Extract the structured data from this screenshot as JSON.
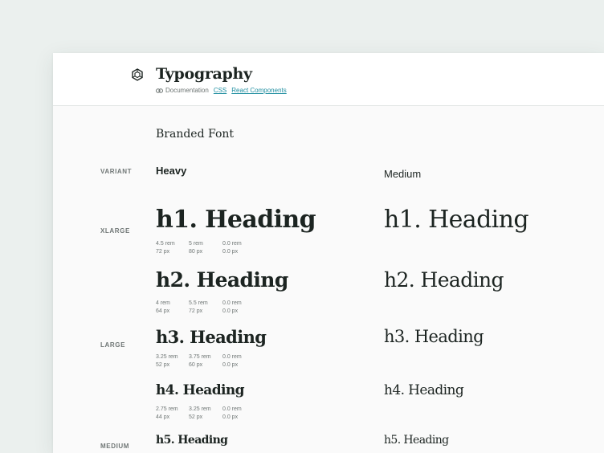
{
  "header": {
    "title": "Typography",
    "links": {
      "documentation": "Documentation",
      "css": "CSS",
      "react": "React Components"
    }
  },
  "section": {
    "title": "Branded Font"
  },
  "labels": {
    "variant": "VARIANT",
    "xlarge": "XLARGE",
    "large": "LARGE",
    "medium": "MEDIUM"
  },
  "variants": {
    "heavy": "Heavy",
    "medium": "Medium"
  },
  "headings": [
    {
      "text": "h1. Heading",
      "font_size": [
        "4.5 rem",
        "72 px"
      ],
      "line_height": [
        "5 rem",
        "80 px"
      ],
      "letter_spacing": [
        "0.0 rem",
        "0.0 px"
      ]
    },
    {
      "text": "h2. Heading",
      "font_size": [
        "4 rem",
        "64 px"
      ],
      "line_height": [
        "5.5 rem",
        "72 px"
      ],
      "letter_spacing": [
        "0.0 rem",
        "0.0 px"
      ]
    },
    {
      "text": "h3. Heading",
      "font_size": [
        "3.25 rem",
        "52 px"
      ],
      "line_height": [
        "3.75 rem",
        "60 px"
      ],
      "letter_spacing": [
        "0.0 rem",
        "0.0 px"
      ]
    },
    {
      "text": "h4. Heading",
      "font_size": [
        "2.75 rem",
        "44 px"
      ],
      "line_height": [
        "3.25 rem",
        "52 px"
      ],
      "letter_spacing": [
        "0.0 rem",
        "0.0 px"
      ]
    },
    {
      "text": "h5. Heading"
    }
  ],
  "colors": {
    "background": "#ebf0ee",
    "card": "#fafafa",
    "text": "#1c2421",
    "muted": "#6f7675",
    "link": "#1f8ea0"
  }
}
